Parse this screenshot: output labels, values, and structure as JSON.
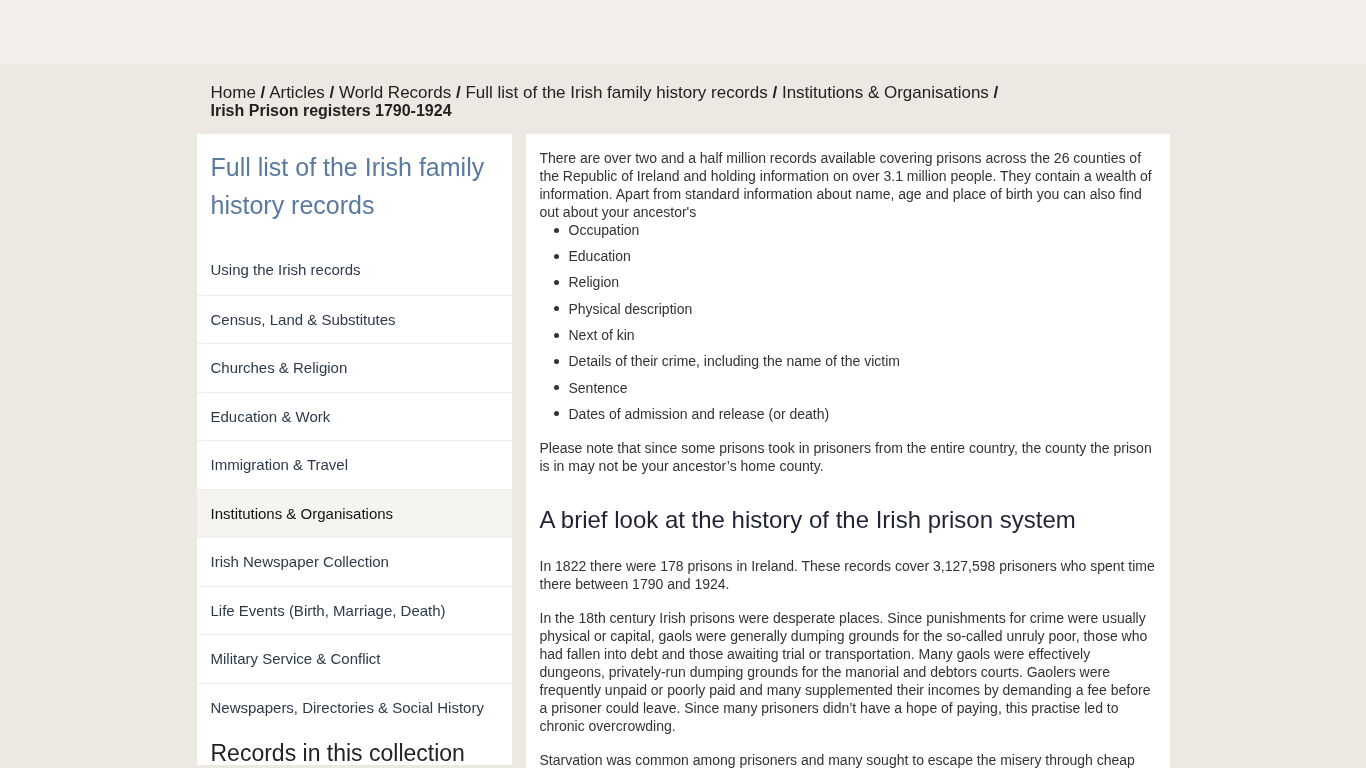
{
  "breadcrumb": {
    "separator": "/",
    "links": [
      "Home",
      "Articles",
      "World Records",
      "Full list of the Irish family history records",
      "Institutions & Organisations"
    ],
    "current": "Irish Prison registers 1790-1924"
  },
  "sidebar": {
    "title": "Full list of the Irish family history records",
    "items": [
      {
        "label": "Using the Irish records",
        "selected": false
      },
      {
        "label": "Census, Land & Substitutes",
        "selected": false
      },
      {
        "label": "Churches & Religion",
        "selected": false
      },
      {
        "label": "Education & Work",
        "selected": false
      },
      {
        "label": "Immigration & Travel",
        "selected": false
      },
      {
        "label": "Institutions & Organisations",
        "selected": true
      },
      {
        "label": "Irish Newspaper Collection",
        "selected": false
      },
      {
        "label": "Life Events (Birth, Marriage, Death)",
        "selected": false
      },
      {
        "label": "Military Service & Conflict",
        "selected": false
      },
      {
        "label": "Newspapers, Directories & Social History",
        "selected": false
      }
    ],
    "section_heading": "Records in this collection"
  },
  "article": {
    "intro": "There are over two and a half million records available covering prisons across the 26 counties of the Republic of Ireland and holding information on over 3.1 million people. They contain a wealth of information. Apart from standard information about name, age and place of birth you can also find out about your ancestor's",
    "bullets": [
      "Occupation",
      "Education",
      "Religion",
      "Physical description",
      "Next of kin",
      "Details of their crime, including the name of the victim",
      "Sentence",
      "Dates of admission and release (or death)"
    ],
    "note": "Please note that since some prisons took in prisoners from the entire country, the county the prison is in may not be your ancestor’s home county.",
    "heading": "A brief look at the history of the Irish prison system",
    "paragraphs": [
      "In 1822 there were 178 prisons in Ireland. These records cover 3,127,598 prisoners who spent time there between 1790 and 1924.",
      "In the 18th century Irish prisons were desperate places. Since punishments for crime were usually physical or capital, gaols were generally dumping grounds for the so-called unruly poor, those who had fallen into debt and those awaiting trial or transportation. Many gaols were effectively dungeons, privately-run dumping grounds for the manorial and debtors courts. Gaolers were frequently unpaid or poorly paid and many supplemented their incomes by demanding a fee before a prisoner could leave. Since many prisoners didn’t have a hope of paying, this practise led to chronic overcrowding.",
      "Starvation was common among prisoners and many sought to escape the misery through cheap"
    ]
  }
}
